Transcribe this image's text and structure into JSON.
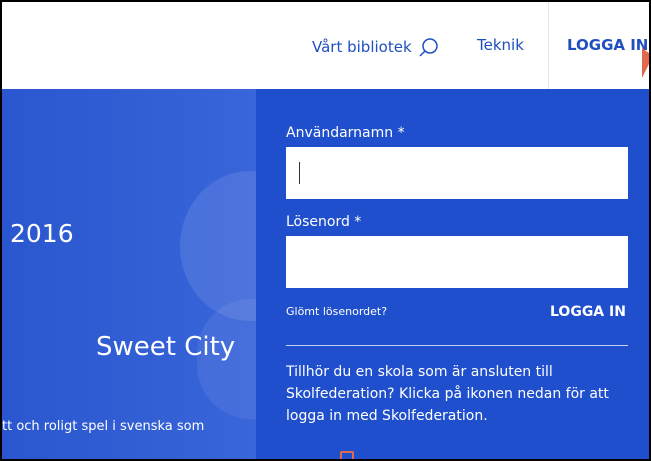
{
  "header": {
    "library_label": "Vårt bibliotek",
    "library_icon": "search-icon",
    "teknik_label": "Teknik",
    "login_label": "LOGGA IN",
    "accent_color": "#1f4fbf"
  },
  "hero": {
    "year": "2016",
    "title": "Sweet City",
    "description": "tt och roligt spel i svenska som"
  },
  "login": {
    "username_label": "Användarnamn *",
    "username_value": "",
    "password_label": "Lösenord *",
    "password_value": "",
    "forgot_link": "Glömt lösenordet?",
    "submit_label": "LOGGA IN",
    "federation_text": "Tillhör du en skola som är ansluten till Skolfederation? Klicka på ikonen nedan för att logga in med Skolfederation.",
    "federation_icon": "skolfederation-icon",
    "panel_color": "#1f4fcc",
    "icon_color": "#e2694c"
  }
}
